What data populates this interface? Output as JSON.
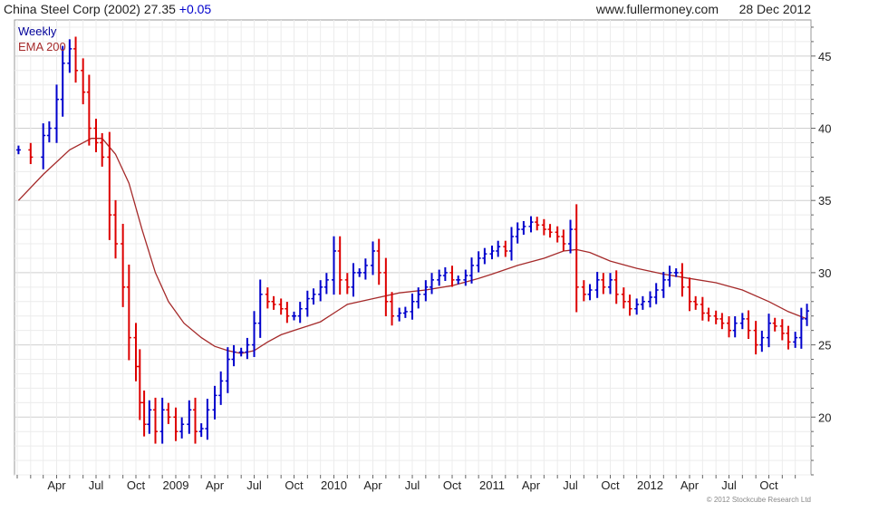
{
  "header": {
    "title_prefix": "China Steel Corp (2002) 27.35 ",
    "change": "+0.05",
    "source": "www.fullermoney.com",
    "date": "28 Dec 2012"
  },
  "legend": {
    "weekly": "Weekly",
    "ema": "EMA 200"
  },
  "footer": {
    "copyright": "© 2012 Stockcube Research Ltd"
  },
  "colors": {
    "up": "#0000cc",
    "down": "#dd0000",
    "ema": "#a52a2a",
    "grid": "#dddddd",
    "change_text": "#0000cc",
    "legend_weekly": "#000099",
    "legend_ema": "#a52a2a"
  },
  "chart_data": {
    "type": "line",
    "title": "China Steel Corp (2002) 27.35 +0.05",
    "style": "weekly price bars with 200-period EMA",
    "ylim": [
      16,
      47.5
    ],
    "y_axis_position": "right",
    "y_ticks": [
      20,
      25,
      30,
      35,
      40,
      45
    ],
    "grid": true,
    "legend_placement": "top-left",
    "x_labels": [
      "Apr",
      "Jul",
      "Oct",
      "2009",
      "Apr",
      "Jul",
      "Oct",
      "2010",
      "Apr",
      "Jul",
      "Oct",
      "2011",
      "Apr",
      "Jul",
      "Oct",
      "2012",
      "Apr",
      "Jul",
      "Oct"
    ],
    "series": [
      {
        "name": "Weekly",
        "kind": "price",
        "x": [
          "2008-01-04",
          "2008-02-01",
          "2008-03-01",
          "2008-03-15",
          "2008-04-01",
          "2008-04-15",
          "2008-05-01",
          "2008-05-15",
          "2008-06-01",
          "2008-06-15",
          "2008-07-01",
          "2008-07-15",
          "2008-08-01",
          "2008-08-15",
          "2008-09-01",
          "2008-09-15",
          "2008-10-01",
          "2008-10-10",
          "2008-10-20",
          "2008-11-01",
          "2008-11-15",
          "2008-12-01",
          "2008-12-15",
          "2009-01-01",
          "2009-01-15",
          "2009-02-01",
          "2009-02-15",
          "2009-03-01",
          "2009-03-15",
          "2009-04-01",
          "2009-04-15",
          "2009-05-01",
          "2009-05-15",
          "2009-06-01",
          "2009-06-15",
          "2009-07-01",
          "2009-07-15",
          "2009-08-01",
          "2009-08-15",
          "2009-09-01",
          "2009-09-15",
          "2009-10-01",
          "2009-10-15",
          "2009-11-01",
          "2009-11-15",
          "2009-12-01",
          "2009-12-15",
          "2010-01-01",
          "2010-01-15",
          "2010-02-01",
          "2010-02-15",
          "2010-03-01",
          "2010-03-15",
          "2010-04-01",
          "2010-04-15",
          "2010-05-01",
          "2010-05-15",
          "2010-06-01",
          "2010-06-15",
          "2010-07-01",
          "2010-07-15",
          "2010-08-01",
          "2010-08-15",
          "2010-09-01",
          "2010-09-15",
          "2010-10-01",
          "2010-10-15",
          "2010-11-01",
          "2010-11-15",
          "2010-12-01",
          "2010-12-15",
          "2011-01-01",
          "2011-01-15",
          "2011-02-01",
          "2011-02-15",
          "2011-03-01",
          "2011-03-15",
          "2011-04-01",
          "2011-04-15",
          "2011-05-01",
          "2011-05-15",
          "2011-06-01",
          "2011-06-15",
          "2011-07-01",
          "2011-07-15",
          "2011-08-01",
          "2011-08-15",
          "2011-09-01",
          "2011-09-15",
          "2011-10-01",
          "2011-10-15",
          "2011-11-01",
          "2011-11-15",
          "2011-12-01",
          "2011-12-15",
          "2012-01-01",
          "2012-01-15",
          "2012-02-01",
          "2012-02-15",
          "2012-03-01",
          "2012-03-15",
          "2012-04-01",
          "2012-04-15",
          "2012-05-01",
          "2012-05-15",
          "2012-06-01",
          "2012-06-15",
          "2012-07-01",
          "2012-07-15",
          "2012-08-01",
          "2012-08-15",
          "2012-09-01",
          "2012-09-15",
          "2012-10-01",
          "2012-10-15",
          "2012-11-01",
          "2012-11-15",
          "2012-12-01",
          "2012-12-15",
          "2012-12-28"
        ],
        "values": [
          38.5,
          38.0,
          39.5,
          40.0,
          42.0,
          44.5,
          45.5,
          44.0,
          42.5,
          40.0,
          39.0,
          38.0,
          34.0,
          32.0,
          29.0,
          25.5,
          23.5,
          21.0,
          19.5,
          20.5,
          19.0,
          20.5,
          20.0,
          19.0,
          19.5,
          20.5,
          19.0,
          19.2,
          20.5,
          21.5,
          22.5,
          24.0,
          24.5,
          24.5,
          25.0,
          26.5,
          28.5,
          28.0,
          27.8,
          27.5,
          27.0,
          27.0,
          27.5,
          28.2,
          28.5,
          29.0,
          29.5,
          31.5,
          29.5,
          29.0,
          30.0,
          30.0,
          30.5,
          31.5,
          30.0,
          28.0,
          27.0,
          27.2,
          27.3,
          28.0,
          28.5,
          29.0,
          29.5,
          29.8,
          30.0,
          29.5,
          29.5,
          29.8,
          30.5,
          31.0,
          31.3,
          31.5,
          31.8,
          31.5,
          32.5,
          33.0,
          33.2,
          33.5,
          33.3,
          33.0,
          32.8,
          32.5,
          32.0,
          33.0,
          29.0,
          28.5,
          28.8,
          29.5,
          29.0,
          29.5,
          28.5,
          28.0,
          27.5,
          27.8,
          28.0,
          28.3,
          28.8,
          29.5,
          30.0,
          30.0,
          29.0,
          28.0,
          27.8,
          27.2,
          27.0,
          26.8,
          26.5,
          26.0,
          26.5,
          26.8,
          26.0,
          25.0,
          25.5,
          26.5,
          26.3,
          25.8,
          25.2,
          25.5,
          26.8,
          27.35
        ]
      },
      {
        "name": "EMA 200",
        "kind": "ema",
        "x": [
          "2008-01-04",
          "2008-03-01",
          "2008-05-01",
          "2008-06-20",
          "2008-07-15",
          "2008-08-15",
          "2008-09-15",
          "2008-10-15",
          "2008-11-15",
          "2008-12-15",
          "2009-01-20",
          "2009-03-01",
          "2009-04-01",
          "2009-05-01",
          "2009-06-01",
          "2009-07-01",
          "2009-08-01",
          "2009-09-01",
          "2009-10-01",
          "2009-11-01",
          "2009-12-01",
          "2010-01-01",
          "2010-02-01",
          "2010-04-01",
          "2010-06-01",
          "2010-08-01",
          "2010-10-01",
          "2010-12-01",
          "2011-01-01",
          "2011-03-01",
          "2011-05-01",
          "2011-06-15",
          "2011-07-15",
          "2011-08-15",
          "2011-10-01",
          "2011-12-01",
          "2012-02-01",
          "2012-04-01",
          "2012-06-01",
          "2012-08-01",
          "2012-10-01",
          "2012-11-15",
          "2012-12-28"
        ],
        "values": [
          35.0,
          36.8,
          38.5,
          39.3,
          39.3,
          38.2,
          36.2,
          33.0,
          30.0,
          28.0,
          26.5,
          25.5,
          24.9,
          24.6,
          24.4,
          24.6,
          25.2,
          25.7,
          26.0,
          26.3,
          26.6,
          27.2,
          27.8,
          28.2,
          28.6,
          28.8,
          29.1,
          29.6,
          29.9,
          30.5,
          31.0,
          31.5,
          31.6,
          31.4,
          30.8,
          30.3,
          29.9,
          29.6,
          29.3,
          28.8,
          28.0,
          27.3,
          26.8
        ]
      }
    ]
  }
}
